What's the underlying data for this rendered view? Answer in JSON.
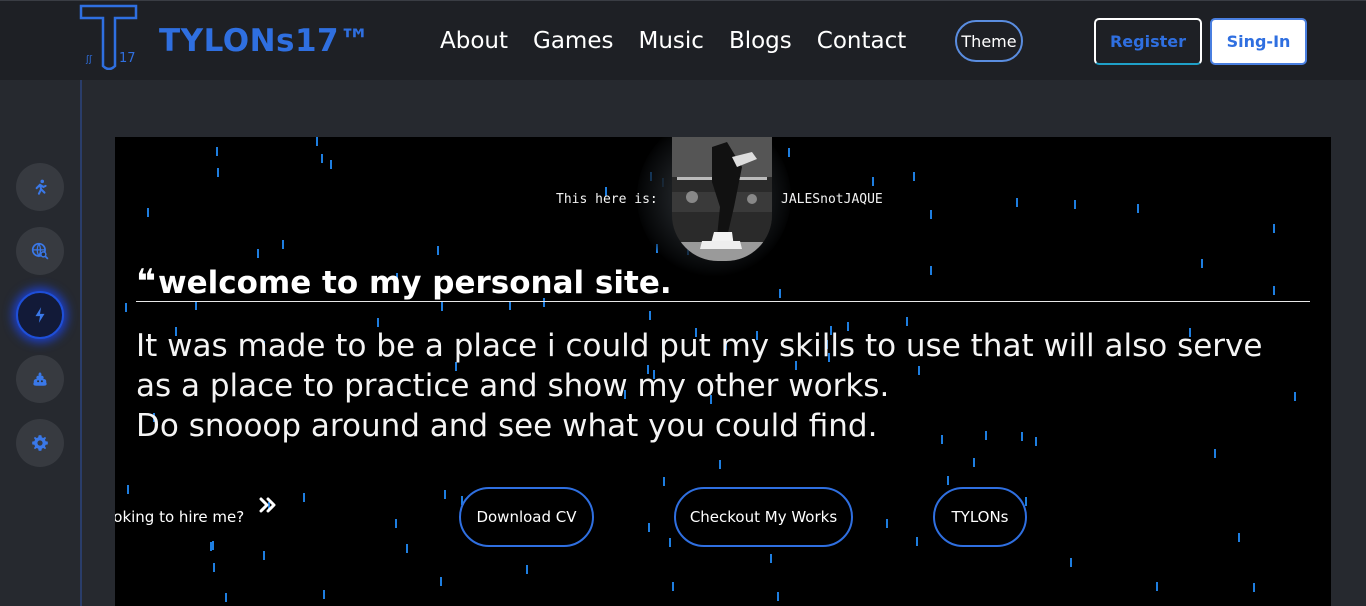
{
  "header": {
    "logo_letter": "T",
    "logo_small_left": "ʃʃ",
    "logo_small_right": "17",
    "brand": "TYLONs17™",
    "nav": [
      "About",
      "Games",
      "Music",
      "Blogs",
      "Contact"
    ],
    "theme_label": "Theme",
    "register_label": "Register",
    "signin_label": "Sing-In"
  },
  "sidebar": {
    "icons": [
      "running-person-icon",
      "globe-search-icon",
      "lightning-icon",
      "poo-icon",
      "gear-icon"
    ],
    "active_index": 2
  },
  "intro": {
    "left_text": "This here is:",
    "right_text": "JALESnotJAQUE"
  },
  "main": {
    "heading": "welcome to my personal site.",
    "quote_mark": "❝",
    "desc_lines": [
      "It was made to be a place i could put my skills to use that will also serve",
      "as a place to practice and show my other works.",
      "Do snooop around and see what you could find."
    ],
    "hire_label": "Looking to hire me?",
    "buttons": {
      "download_cv": "Download CV",
      "checkout_works": "Checkout My Works",
      "tylons": "TYLONs"
    }
  },
  "colors": {
    "accent": "#2f6fe0",
    "background": "#26292f",
    "topbar": "#1e2025",
    "panel": "#000000",
    "rain": "#1e7ee0"
  }
}
